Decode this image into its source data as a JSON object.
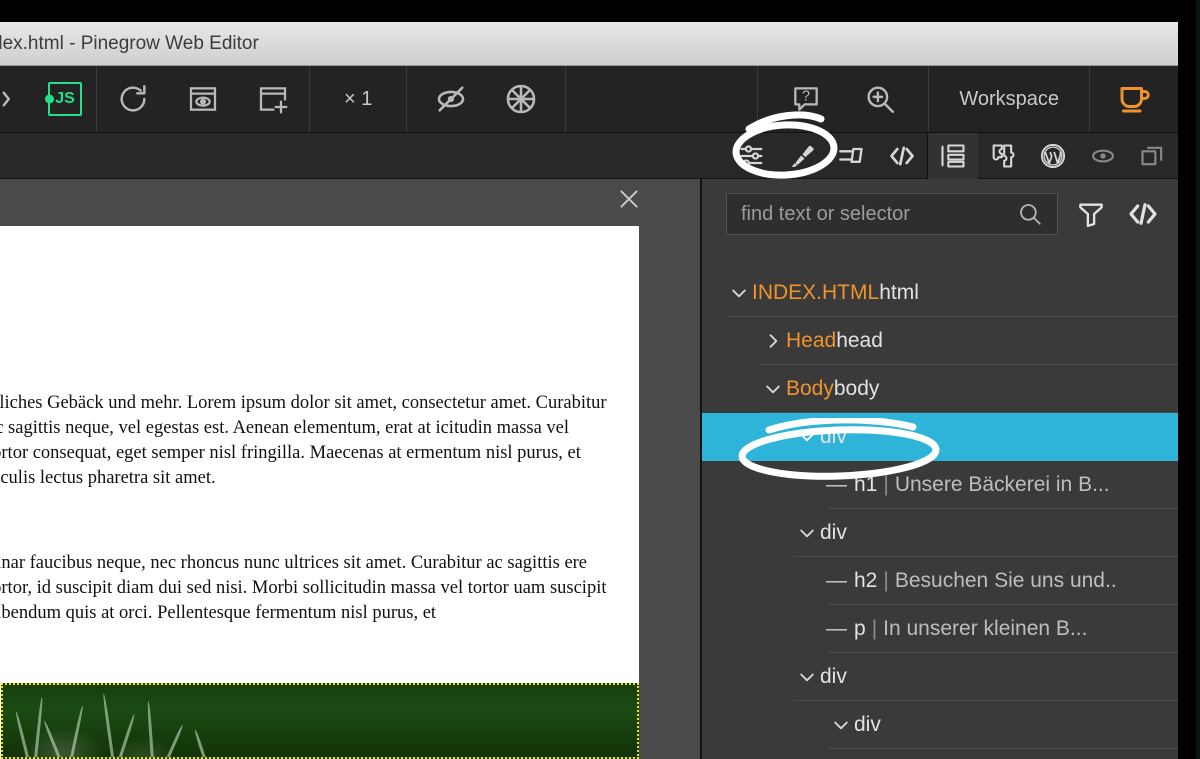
{
  "window": {
    "title": "dex.html - Pinegrow Web Editor"
  },
  "toolbar": {
    "code_icon": "code-angle-brackets-icon",
    "js_badge": "JS",
    "reload_icon": "reload-icon",
    "preview_icon": "preview-page-icon",
    "new_page_icon": "new-page-icon",
    "zoom_level": "× 1",
    "hide_icon": "eye-slash-icon",
    "snap_icon": "snap-target-icon",
    "help_icon": "help-question-icon",
    "magnify_icon": "magnify-plus-icon",
    "workspace_label": "Workspace",
    "coffee_icon": "coffee-cup-icon"
  },
  "subbar": {
    "items": [
      {
        "name": "sliders-icon",
        "label": "Properties"
      },
      {
        "name": "paint-brush-icon",
        "label": "Style"
      },
      {
        "name": "edit-block-icon",
        "label": "Edit"
      },
      {
        "name": "code-icon",
        "label": "Code"
      },
      {
        "name": "outline-tree-icon",
        "label": "Page outline"
      },
      {
        "name": "puzzle-icon",
        "label": "Library"
      },
      {
        "name": "wordpress-icon",
        "label": "WordPress"
      },
      {
        "name": "eye-icon",
        "label": "Visibility"
      },
      {
        "name": "layers-icon",
        "label": "Layers"
      }
    ]
  },
  "preview": {
    "close_icon": "close-x-icon",
    "heading": "!",
    "paragraph1": "stliches Gebäck und mehr.  Lorem ipsum dolor sit amet, consectetur amet. Curabitur ac sagittis neque, vel egestas est. Aenean elementum, erat at icitudin massa vel tortor consequat, eget semper nisl fringilla. Maecenas at ermentum nisl purus, et iaculis lectus pharetra sit amet.",
    "paragraph2": "vinar faucibus neque, nec rhoncus nunc ultrices sit amet. Curabitur ac sagittis ere tortor, id suscipit diam dui sed nisi. Morbi sollicitudin massa vel tortor uam suscipit bibendum quis at orci. Pellentesque fermentum nisl purus, et",
    "image_alt": "grass-photo"
  },
  "sidebar": {
    "search": {
      "placeholder": "find text or selector",
      "value": "",
      "icon": "search-icon"
    },
    "filter_icon": "filter-funnel-icon",
    "code_icon": "code-angle-brackets-icon",
    "tree": [
      {
        "indent": 0,
        "caret": "down",
        "name": "INDEX.HTML",
        "tag": "html",
        "text": "",
        "selected": false
      },
      {
        "indent": 1,
        "caret": "right",
        "name": "Head",
        "tag": "head",
        "text": "",
        "selected": false
      },
      {
        "indent": 1,
        "caret": "down",
        "name": "Body",
        "tag": "body",
        "text": "",
        "selected": false
      },
      {
        "indent": 2,
        "caret": "down",
        "name": "",
        "tag": "div",
        "text": "",
        "selected": true
      },
      {
        "indent": 3,
        "caret": "dash",
        "name": "",
        "tag": "h1",
        "text": "Unsere Bäckerei in B...",
        "selected": false
      },
      {
        "indent": 2,
        "caret": "down",
        "name": "",
        "tag": "div",
        "text": "",
        "selected": false
      },
      {
        "indent": 3,
        "caret": "dash",
        "name": "",
        "tag": "h2",
        "text": "Besuchen Sie uns und..",
        "selected": false
      },
      {
        "indent": 3,
        "caret": "dash",
        "name": "",
        "tag": "p",
        "text": "In unserer kleinen B...",
        "selected": false
      },
      {
        "indent": 2,
        "caret": "down",
        "name": "",
        "tag": "div",
        "text": "",
        "selected": false
      },
      {
        "indent": 3,
        "caret": "down",
        "name": "",
        "tag": "div",
        "text": "",
        "selected": false
      }
    ]
  },
  "annotations": [
    {
      "name": "brush-tool-circle",
      "shape": "hand-drawn-ellipse",
      "color": "#ffffff"
    },
    {
      "name": "selected-div-circle",
      "shape": "hand-drawn-ellipse",
      "color": "#ffffff"
    }
  ],
  "colors": {
    "accent_orange": "#f0932b",
    "selection_cyan": "#2fb4d9",
    "js_green": "#23e08a",
    "panel_bg": "#3a3a3a",
    "toolbar_bg": "#232323",
    "selection_dotted": "#f2e000"
  }
}
